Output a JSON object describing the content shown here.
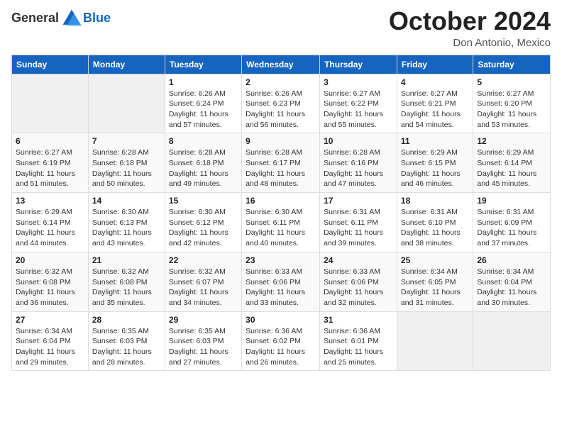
{
  "logo": {
    "general": "General",
    "blue": "Blue"
  },
  "header": {
    "month": "October 2024",
    "location": "Don Antonio, Mexico"
  },
  "weekdays": [
    "Sunday",
    "Monday",
    "Tuesday",
    "Wednesday",
    "Thursday",
    "Friday",
    "Saturday"
  ],
  "weeks": [
    [
      {
        "day": "",
        "sunrise": "",
        "sunset": "",
        "daylight": ""
      },
      {
        "day": "",
        "sunrise": "",
        "sunset": "",
        "daylight": ""
      },
      {
        "day": "1",
        "sunrise": "Sunrise: 6:26 AM",
        "sunset": "Sunset: 6:24 PM",
        "daylight": "Daylight: 11 hours and 57 minutes."
      },
      {
        "day": "2",
        "sunrise": "Sunrise: 6:26 AM",
        "sunset": "Sunset: 6:23 PM",
        "daylight": "Daylight: 11 hours and 56 minutes."
      },
      {
        "day": "3",
        "sunrise": "Sunrise: 6:27 AM",
        "sunset": "Sunset: 6:22 PM",
        "daylight": "Daylight: 11 hours and 55 minutes."
      },
      {
        "day": "4",
        "sunrise": "Sunrise: 6:27 AM",
        "sunset": "Sunset: 6:21 PM",
        "daylight": "Daylight: 11 hours and 54 minutes."
      },
      {
        "day": "5",
        "sunrise": "Sunrise: 6:27 AM",
        "sunset": "Sunset: 6:20 PM",
        "daylight": "Daylight: 11 hours and 53 minutes."
      }
    ],
    [
      {
        "day": "6",
        "sunrise": "Sunrise: 6:27 AM",
        "sunset": "Sunset: 6:19 PM",
        "daylight": "Daylight: 11 hours and 51 minutes."
      },
      {
        "day": "7",
        "sunrise": "Sunrise: 6:28 AM",
        "sunset": "Sunset: 6:18 PM",
        "daylight": "Daylight: 11 hours and 50 minutes."
      },
      {
        "day": "8",
        "sunrise": "Sunrise: 6:28 AM",
        "sunset": "Sunset: 6:18 PM",
        "daylight": "Daylight: 11 hours and 49 minutes."
      },
      {
        "day": "9",
        "sunrise": "Sunrise: 6:28 AM",
        "sunset": "Sunset: 6:17 PM",
        "daylight": "Daylight: 11 hours and 48 minutes."
      },
      {
        "day": "10",
        "sunrise": "Sunrise: 6:28 AM",
        "sunset": "Sunset: 6:16 PM",
        "daylight": "Daylight: 11 hours and 47 minutes."
      },
      {
        "day": "11",
        "sunrise": "Sunrise: 6:29 AM",
        "sunset": "Sunset: 6:15 PM",
        "daylight": "Daylight: 11 hours and 46 minutes."
      },
      {
        "day": "12",
        "sunrise": "Sunrise: 6:29 AM",
        "sunset": "Sunset: 6:14 PM",
        "daylight": "Daylight: 11 hours and 45 minutes."
      }
    ],
    [
      {
        "day": "13",
        "sunrise": "Sunrise: 6:29 AM",
        "sunset": "Sunset: 6:14 PM",
        "daylight": "Daylight: 11 hours and 44 minutes."
      },
      {
        "day": "14",
        "sunrise": "Sunrise: 6:30 AM",
        "sunset": "Sunset: 6:13 PM",
        "daylight": "Daylight: 11 hours and 43 minutes."
      },
      {
        "day": "15",
        "sunrise": "Sunrise: 6:30 AM",
        "sunset": "Sunset: 6:12 PM",
        "daylight": "Daylight: 11 hours and 42 minutes."
      },
      {
        "day": "16",
        "sunrise": "Sunrise: 6:30 AM",
        "sunset": "Sunset: 6:11 PM",
        "daylight": "Daylight: 11 hours and 40 minutes."
      },
      {
        "day": "17",
        "sunrise": "Sunrise: 6:31 AM",
        "sunset": "Sunset: 6:11 PM",
        "daylight": "Daylight: 11 hours and 39 minutes."
      },
      {
        "day": "18",
        "sunrise": "Sunrise: 6:31 AM",
        "sunset": "Sunset: 6:10 PM",
        "daylight": "Daylight: 11 hours and 38 minutes."
      },
      {
        "day": "19",
        "sunrise": "Sunrise: 6:31 AM",
        "sunset": "Sunset: 6:09 PM",
        "daylight": "Daylight: 11 hours and 37 minutes."
      }
    ],
    [
      {
        "day": "20",
        "sunrise": "Sunrise: 6:32 AM",
        "sunset": "Sunset: 6:08 PM",
        "daylight": "Daylight: 11 hours and 36 minutes."
      },
      {
        "day": "21",
        "sunrise": "Sunrise: 6:32 AM",
        "sunset": "Sunset: 6:08 PM",
        "daylight": "Daylight: 11 hours and 35 minutes."
      },
      {
        "day": "22",
        "sunrise": "Sunrise: 6:32 AM",
        "sunset": "Sunset: 6:07 PM",
        "daylight": "Daylight: 11 hours and 34 minutes."
      },
      {
        "day": "23",
        "sunrise": "Sunrise: 6:33 AM",
        "sunset": "Sunset: 6:06 PM",
        "daylight": "Daylight: 11 hours and 33 minutes."
      },
      {
        "day": "24",
        "sunrise": "Sunrise: 6:33 AM",
        "sunset": "Sunset: 6:06 PM",
        "daylight": "Daylight: 11 hours and 32 minutes."
      },
      {
        "day": "25",
        "sunrise": "Sunrise: 6:34 AM",
        "sunset": "Sunset: 6:05 PM",
        "daylight": "Daylight: 11 hours and 31 minutes."
      },
      {
        "day": "26",
        "sunrise": "Sunrise: 6:34 AM",
        "sunset": "Sunset: 6:04 PM",
        "daylight": "Daylight: 11 hours and 30 minutes."
      }
    ],
    [
      {
        "day": "27",
        "sunrise": "Sunrise: 6:34 AM",
        "sunset": "Sunset: 6:04 PM",
        "daylight": "Daylight: 11 hours and 29 minutes."
      },
      {
        "day": "28",
        "sunrise": "Sunrise: 6:35 AM",
        "sunset": "Sunset: 6:03 PM",
        "daylight": "Daylight: 11 hours and 28 minutes."
      },
      {
        "day": "29",
        "sunrise": "Sunrise: 6:35 AM",
        "sunset": "Sunset: 6:03 PM",
        "daylight": "Daylight: 11 hours and 27 minutes."
      },
      {
        "day": "30",
        "sunrise": "Sunrise: 6:36 AM",
        "sunset": "Sunset: 6:02 PM",
        "daylight": "Daylight: 11 hours and 26 minutes."
      },
      {
        "day": "31",
        "sunrise": "Sunrise: 6:36 AM",
        "sunset": "Sunset: 6:01 PM",
        "daylight": "Daylight: 11 hours and 25 minutes."
      },
      {
        "day": "",
        "sunrise": "",
        "sunset": "",
        "daylight": ""
      },
      {
        "day": "",
        "sunrise": "",
        "sunset": "",
        "daylight": ""
      }
    ]
  ]
}
